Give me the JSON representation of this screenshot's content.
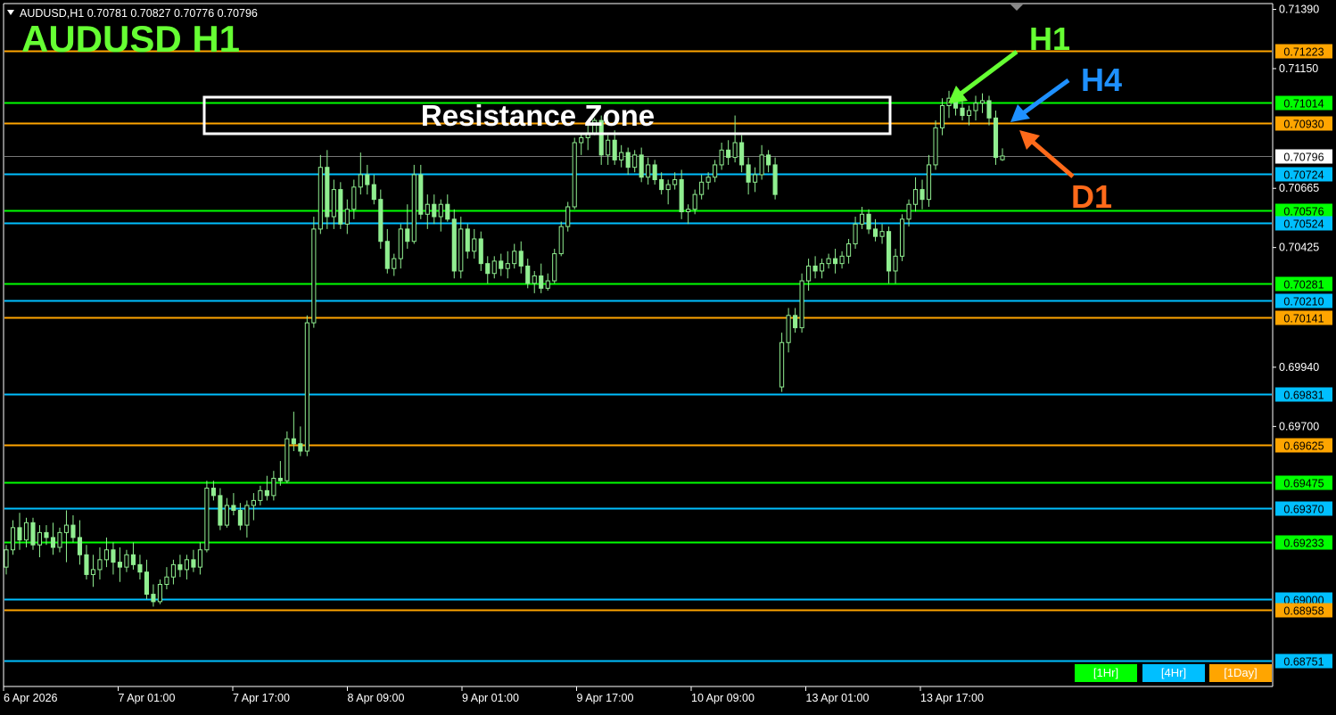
{
  "header": {
    "symbol_line": "AUDUSD,H1  0.70781 0.70827 0.70776 0.70796",
    "big_title": "AUDUSD  H1"
  },
  "annotations": {
    "resistance_label": "Resistance Zone",
    "arrow_h1": "H1",
    "arrow_h4": "H4",
    "arrow_d1": "D1"
  },
  "timeframe_buttons": [
    "[1Hr]",
    "[4Hr]",
    "[1Day]"
  ],
  "colors": {
    "background": "#000000",
    "candle": "#90ee90",
    "h1_line": "#00ff00",
    "h4_line": "#00bfff",
    "d1_line": "#ffa500",
    "h1_text": "#66ff33",
    "h4_text": "#1e90ff",
    "d1_text": "#ff6a1a",
    "axis_text": "#ffffff"
  },
  "chart_data": {
    "type": "candlestick",
    "symbol": "AUDUSD",
    "timeframe": "H1",
    "ylim": [
      0.6865,
      0.7141
    ],
    "y_ticks": [
      "0.71390",
      "0.71150",
      "0.70665",
      "0.70425",
      "0.69940",
      "0.69700"
    ],
    "x_ticks": [
      "6 Apr 2026",
      "7 Apr 01:00",
      "7 Apr 17:00",
      "8 Apr 09:00",
      "9 Apr 01:00",
      "9 Apr 17:00",
      "10 Apr 09:00",
      "13 Apr 01:00",
      "13 Apr 17:00"
    ],
    "current_price": "0.70796",
    "levels": [
      {
        "label": "0.71223",
        "value": 0.71223,
        "tf": "d1"
      },
      {
        "label": "0.71014",
        "value": 0.71014,
        "tf": "h1"
      },
      {
        "label": "0.70930",
        "value": 0.7093,
        "tf": "d1"
      },
      {
        "label": "0.70724",
        "value": 0.70724,
        "tf": "h4"
      },
      {
        "label": "0.70576",
        "value": 0.70576,
        "tf": "h1"
      },
      {
        "label": "0.70524",
        "value": 0.70524,
        "tf": "h4"
      },
      {
        "label": "0.70281",
        "value": 0.70281,
        "tf": "h1"
      },
      {
        "label": "0.70210",
        "value": 0.7021,
        "tf": "h4"
      },
      {
        "label": "0.70141",
        "value": 0.70141,
        "tf": "d1"
      },
      {
        "label": "0.69831",
        "value": 0.69831,
        "tf": "h4"
      },
      {
        "label": "0.69625",
        "value": 0.69625,
        "tf": "d1"
      },
      {
        "label": "0.69475",
        "value": 0.69475,
        "tf": "h1"
      },
      {
        "label": "0.69370",
        "value": 0.6937,
        "tf": "h4"
      },
      {
        "label": "0.69233",
        "value": 0.69233,
        "tf": "h1"
      },
      {
        "label": "0.69000",
        "value": 0.69,
        "tf": "h4"
      },
      {
        "label": "0.68958",
        "value": 0.68958,
        "tf": "d1"
      },
      {
        "label": "0.68751",
        "value": 0.68751,
        "tf": "h4"
      }
    ],
    "resistance_zone": [
      0.7093,
      0.711
    ],
    "candles": [
      [
        0.6913,
        0.6922,
        0.691,
        0.692
      ],
      [
        0.692,
        0.6932,
        0.6918,
        0.6929
      ],
      [
        0.6929,
        0.6935,
        0.692,
        0.6924
      ],
      [
        0.6924,
        0.6933,
        0.6921,
        0.6931
      ],
      [
        0.6931,
        0.6933,
        0.692,
        0.6922
      ],
      [
        0.6922,
        0.693,
        0.6917,
        0.6927
      ],
      [
        0.6927,
        0.693,
        0.6922,
        0.6925
      ],
      [
        0.6925,
        0.6931,
        0.6918,
        0.6921
      ],
      [
        0.6921,
        0.6929,
        0.6919,
        0.6927
      ],
      [
        0.6927,
        0.6936,
        0.6915,
        0.693
      ],
      [
        0.693,
        0.6934,
        0.6923,
        0.6925
      ],
      [
        0.6925,
        0.6932,
        0.6914,
        0.6918
      ],
      [
        0.6918,
        0.6922,
        0.6908,
        0.691
      ],
      [
        0.691,
        0.6918,
        0.6905,
        0.6912
      ],
      [
        0.6912,
        0.6921,
        0.6908,
        0.6916
      ],
      [
        0.6916,
        0.6925,
        0.6913,
        0.692
      ],
      [
        0.692,
        0.6923,
        0.691,
        0.6915
      ],
      [
        0.6915,
        0.6921,
        0.6907,
        0.6913
      ],
      [
        0.6913,
        0.692,
        0.6911,
        0.6918
      ],
      [
        0.6918,
        0.6923,
        0.6912,
        0.6914
      ],
      [
        0.6914,
        0.6918,
        0.6908,
        0.6911
      ],
      [
        0.6911,
        0.6916,
        0.69,
        0.6902
      ],
      [
        0.6902,
        0.6906,
        0.6897,
        0.6899
      ],
      [
        0.6899,
        0.6908,
        0.6898,
        0.6906
      ],
      [
        0.6906,
        0.6913,
        0.6904,
        0.6909
      ],
      [
        0.6909,
        0.6916,
        0.6906,
        0.6914
      ],
      [
        0.6914,
        0.6918,
        0.6909,
        0.6912
      ],
      [
        0.6912,
        0.6918,
        0.6908,
        0.6916
      ],
      [
        0.6916,
        0.692,
        0.6911,
        0.6913
      ],
      [
        0.6913,
        0.6923,
        0.691,
        0.692
      ],
      [
        0.692,
        0.6948,
        0.6919,
        0.6945
      ],
      [
        0.6945,
        0.6948,
        0.694,
        0.6942
      ],
      [
        0.6942,
        0.6945,
        0.6928,
        0.693
      ],
      [
        0.693,
        0.6941,
        0.6929,
        0.6938
      ],
      [
        0.6938,
        0.6943,
        0.6934,
        0.6936
      ],
      [
        0.6936,
        0.6939,
        0.6928,
        0.693
      ],
      [
        0.693,
        0.694,
        0.6925,
        0.6938
      ],
      [
        0.6938,
        0.6943,
        0.6932,
        0.694
      ],
      [
        0.694,
        0.6946,
        0.6938,
        0.6944
      ],
      [
        0.6944,
        0.695,
        0.694,
        0.6942
      ],
      [
        0.6942,
        0.6952,
        0.694,
        0.6949
      ],
      [
        0.6949,
        0.6956,
        0.6946,
        0.6948
      ],
      [
        0.6948,
        0.6968,
        0.6947,
        0.6965
      ],
      [
        0.6965,
        0.6976,
        0.696,
        0.6963
      ],
      [
        0.6963,
        0.697,
        0.6958,
        0.696
      ],
      [
        0.696,
        0.7015,
        0.6958,
        0.7012
      ],
      [
        0.7012,
        0.7055,
        0.701,
        0.705
      ],
      [
        0.705,
        0.708,
        0.7048,
        0.7075
      ],
      [
        0.7075,
        0.7082,
        0.705,
        0.7055
      ],
      [
        0.7055,
        0.707,
        0.705,
        0.7066
      ],
      [
        0.7066,
        0.7069,
        0.705,
        0.7052
      ],
      [
        0.7052,
        0.7062,
        0.7048,
        0.7058
      ],
      [
        0.7058,
        0.707,
        0.7054,
        0.7067
      ],
      [
        0.7067,
        0.7081,
        0.7064,
        0.7072
      ],
      [
        0.7072,
        0.7076,
        0.7064,
        0.7068
      ],
      [
        0.7068,
        0.7072,
        0.706,
        0.7062
      ],
      [
        0.7062,
        0.7066,
        0.7042,
        0.7045
      ],
      [
        0.7045,
        0.705,
        0.7032,
        0.7034
      ],
      [
        0.7034,
        0.704,
        0.7031,
        0.7038
      ],
      [
        0.7038,
        0.7052,
        0.7034,
        0.705
      ],
      [
        0.705,
        0.706,
        0.7042,
        0.7045
      ],
      [
        0.7045,
        0.7076,
        0.7044,
        0.7072
      ],
      [
        0.7072,
        0.7076,
        0.7054,
        0.7056
      ],
      [
        0.7056,
        0.7064,
        0.705,
        0.706
      ],
      [
        0.706,
        0.7064,
        0.7052,
        0.7055
      ],
      [
        0.7055,
        0.7062,
        0.7049,
        0.706
      ],
      [
        0.706,
        0.7064,
        0.7053,
        0.7054
      ],
      [
        0.7054,
        0.7058,
        0.703,
        0.7033
      ],
      [
        0.7033,
        0.7055,
        0.703,
        0.705
      ],
      [
        0.705,
        0.7052,
        0.7038,
        0.7041
      ],
      [
        0.7041,
        0.705,
        0.7038,
        0.7046
      ],
      [
        0.7046,
        0.7049,
        0.7033,
        0.7036
      ],
      [
        0.7036,
        0.7039,
        0.7028,
        0.7032
      ],
      [
        0.7032,
        0.7039,
        0.703,
        0.7037
      ],
      [
        0.7037,
        0.704,
        0.7031,
        0.7034
      ],
      [
        0.7034,
        0.7041,
        0.703,
        0.7036
      ],
      [
        0.7036,
        0.7044,
        0.7034,
        0.7041
      ],
      [
        0.7041,
        0.7045,
        0.7032,
        0.7035
      ],
      [
        0.7035,
        0.7038,
        0.7026,
        0.7028
      ],
      [
        0.7028,
        0.7033,
        0.7024,
        0.7031
      ],
      [
        0.7031,
        0.7036,
        0.7024,
        0.7026
      ],
      [
        0.7026,
        0.7032,
        0.7025,
        0.7029
      ],
      [
        0.7029,
        0.7042,
        0.7028,
        0.704
      ],
      [
        0.704,
        0.7053,
        0.7039,
        0.7051
      ],
      [
        0.7051,
        0.7061,
        0.7049,
        0.7059
      ],
      [
        0.7059,
        0.7087,
        0.7058,
        0.7085
      ],
      [
        0.7085,
        0.7089,
        0.708,
        0.7087
      ],
      [
        0.7087,
        0.7094,
        0.7082,
        0.7089
      ],
      [
        0.7089,
        0.7095,
        0.7088,
        0.7094
      ],
      [
        0.7094,
        0.7096,
        0.7076,
        0.708
      ],
      [
        0.708,
        0.7088,
        0.7076,
        0.7086
      ],
      [
        0.7086,
        0.709,
        0.7076,
        0.7078
      ],
      [
        0.7078,
        0.7084,
        0.7075,
        0.7081
      ],
      [
        0.7081,
        0.7083,
        0.7072,
        0.7075
      ],
      [
        0.7075,
        0.7082,
        0.7073,
        0.708
      ],
      [
        0.708,
        0.7083,
        0.7069,
        0.7071
      ],
      [
        0.7071,
        0.7079,
        0.7068,
        0.7076
      ],
      [
        0.7076,
        0.7078,
        0.7068,
        0.707
      ],
      [
        0.707,
        0.7073,
        0.7064,
        0.7066
      ],
      [
        0.7066,
        0.707,
        0.706,
        0.7068
      ],
      [
        0.7068,
        0.7073,
        0.7066,
        0.707
      ],
      [
        0.707,
        0.7074,
        0.7054,
        0.7057
      ],
      [
        0.7057,
        0.706,
        0.7052,
        0.7058
      ],
      [
        0.7058,
        0.7066,
        0.7056,
        0.7064
      ],
      [
        0.7064,
        0.7072,
        0.7062,
        0.7069
      ],
      [
        0.7069,
        0.7073,
        0.7066,
        0.7071
      ],
      [
        0.7071,
        0.7078,
        0.7069,
        0.7076
      ],
      [
        0.7076,
        0.7085,
        0.7074,
        0.7082
      ],
      [
        0.7082,
        0.7086,
        0.7076,
        0.7079
      ],
      [
        0.7079,
        0.7096,
        0.7077,
        0.7085
      ],
      [
        0.7085,
        0.7088,
        0.7073,
        0.7076
      ],
      [
        0.7076,
        0.7079,
        0.7064,
        0.7069
      ],
      [
        0.7069,
        0.7075,
        0.7065,
        0.7072
      ],
      [
        0.7072,
        0.7084,
        0.707,
        0.708
      ],
      [
        0.708,
        0.7082,
        0.7073,
        0.7076
      ],
      [
        0.7076,
        0.7079,
        0.7062,
        0.7064
      ],
      [
        0.6986,
        0.7008,
        0.6984,
        0.7004
      ],
      [
        0.7004,
        0.7018,
        0.7,
        0.7015
      ],
      [
        0.7015,
        0.7018,
        0.7008,
        0.701
      ],
      [
        0.701,
        0.7032,
        0.7008,
        0.7029
      ],
      [
        0.7029,
        0.7038,
        0.7025,
        0.7035
      ],
      [
        0.7035,
        0.7039,
        0.703,
        0.7033
      ],
      [
        0.7033,
        0.7038,
        0.703,
        0.7036
      ],
      [
        0.7036,
        0.704,
        0.7034,
        0.7038
      ],
      [
        0.7038,
        0.7042,
        0.7032,
        0.7036
      ],
      [
        0.7036,
        0.7041,
        0.7034,
        0.7039
      ],
      [
        0.7039,
        0.7046,
        0.7036,
        0.7044
      ],
      [
        0.7044,
        0.7055,
        0.7042,
        0.7052
      ],
      [
        0.7052,
        0.7059,
        0.705,
        0.7056
      ],
      [
        0.7056,
        0.7058,
        0.7048,
        0.705
      ],
      [
        0.705,
        0.7054,
        0.7045,
        0.7047
      ],
      [
        0.7047,
        0.7052,
        0.7044,
        0.7049
      ],
      [
        0.7049,
        0.7051,
        0.7028,
        0.7033
      ],
      [
        0.7033,
        0.7042,
        0.7028,
        0.7039
      ],
      [
        0.7039,
        0.7056,
        0.7037,
        0.7054
      ],
      [
        0.7054,
        0.7062,
        0.7051,
        0.706
      ],
      [
        0.706,
        0.7071,
        0.7057,
        0.7066
      ],
      [
        0.7066,
        0.707,
        0.7058,
        0.7062
      ],
      [
        0.7062,
        0.708,
        0.7059,
        0.7076
      ],
      [
        0.7076,
        0.7094,
        0.7074,
        0.7091
      ],
      [
        0.7091,
        0.7103,
        0.7088,
        0.71
      ],
      [
        0.71,
        0.7106,
        0.7095,
        0.7103
      ],
      [
        0.7103,
        0.7106,
        0.7096,
        0.7099
      ],
      [
        0.7099,
        0.7102,
        0.7094,
        0.7096
      ],
      [
        0.7096,
        0.71,
        0.7092,
        0.7098
      ],
      [
        0.7098,
        0.7104,
        0.7094,
        0.7101
      ],
      [
        0.7101,
        0.7105,
        0.7097,
        0.7102
      ],
      [
        0.7102,
        0.7104,
        0.7092,
        0.7095
      ],
      [
        0.7095,
        0.7098,
        0.7076,
        0.7079
      ],
      [
        0.70781,
        0.70827,
        0.70776,
        0.70796
      ]
    ]
  }
}
